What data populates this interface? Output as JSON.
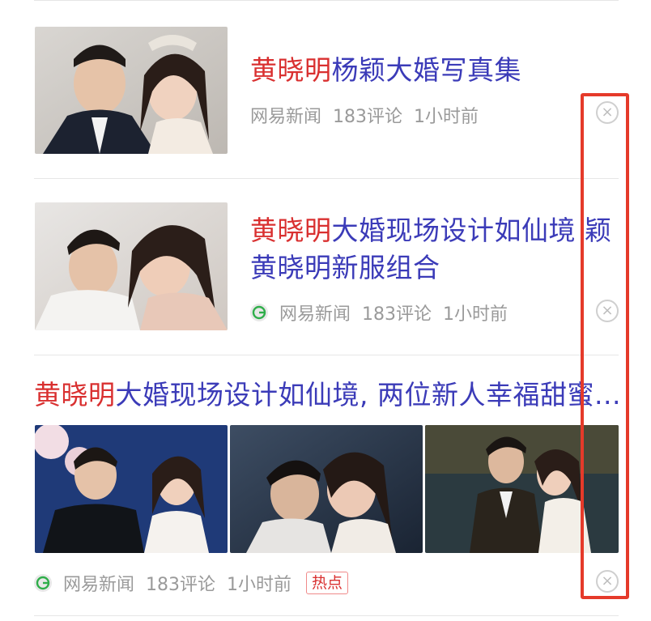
{
  "items": [
    {
      "title_highlight": "黄晓明",
      "title_rest": "杨颖大婚写真集",
      "source": "网易新闻",
      "comments": "183评论",
      "time": "1小时前"
    },
    {
      "title_highlight": "黄晓明",
      "title_rest_line1": "大婚现场设计如仙境 颖",
      "title_line2": "黄晓明新服组合",
      "source": "网易新闻",
      "comments": "183评论",
      "time": "1小时前"
    },
    {
      "title_highlight": "黄晓明",
      "title_rest": "大婚现场设计如仙境, 两位新人幸福甜蜜...",
      "source": "网易新闻",
      "comments": "183评论",
      "time": "1小时前",
      "badge": "热点"
    }
  ],
  "icons": {
    "close": "close-icon",
    "source": "source-logo-icon"
  },
  "colors": {
    "title": "#3b3bb8",
    "highlight": "#d93030",
    "meta": "#9a9a9a",
    "annotation_box": "#e53a2a"
  }
}
